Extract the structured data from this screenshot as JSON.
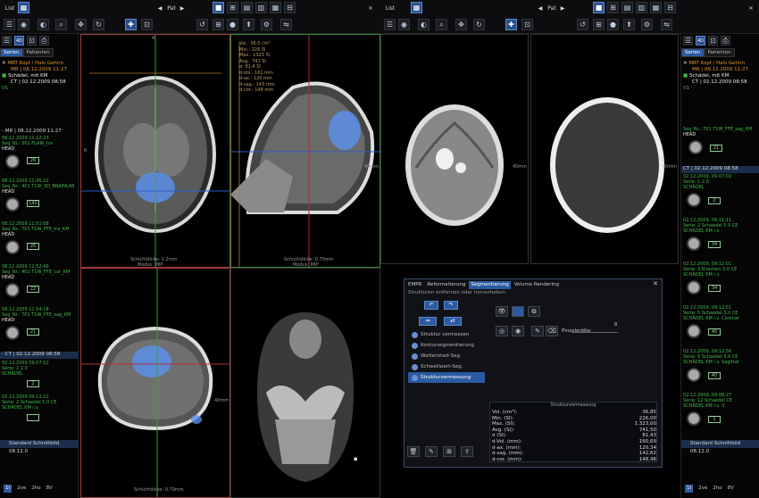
{
  "toolbar": {
    "list_label_left": "List",
    "pat_label_left": "Pat",
    "list_label_right": "List",
    "pat_label_right": "Pat"
  },
  "sidebar_left": {
    "tabs": [
      "Serien",
      "Patienten"
    ],
    "patient_lines": [
      "MRT Kopf / Hals Gehirn",
      "MR | 08.12.2009 11:27",
      "Schädel, mit KM",
      "CT | 02.12.2009 08:58"
    ],
    "version": "V1",
    "group_header": "- MR | 08.12.2009 11:27",
    "series": [
      {
        "time": "08.12.2009 11:22:23",
        "line2": "Seq_Nr.: 301 FLAIR_tra",
        "line3": "HEAD",
        "count": "26"
      },
      {
        "time": "08.12.2009 11:45:22",
        "line2": "Seq_Nr.: 401 T1W_3D_BRAINLAB",
        "line3": "HEAD",
        "count": "140"
      },
      {
        "time": "08.12.2009 11:51:08",
        "line2": "Seq_Nr.: 701 T1W_FFE_tra_KM",
        "line3": "HEAD",
        "count": "26"
      },
      {
        "time": "08.12.2009 11:52:49",
        "line2": "Seq_Nr.: 401 T1W_FFE_cor_KM",
        "line3": "HEAD",
        "count": "22"
      },
      {
        "time": "08.12.2009 11:54:18",
        "line2": "Seq_Nr.: 701 T1W_FFE_sag_KM",
        "line3": "HEAD",
        "count": "21"
      }
    ],
    "ct_header": "- CT | 02.12.2009 08:58",
    "ct_series": [
      {
        "time": "02.12.2009 09:07:02",
        "line2": "Serie: 1 2.0",
        "line3": "SCHÄDEL",
        "count": "2"
      },
      {
        "time": "02.12.2009 09:11:11",
        "line2": "Serie: 2 Schaedel 5.0 CE",
        "line3": "SCHÄDEL KM i.v.",
        "count": ""
      }
    ],
    "footer": "Standard Schnittbild 08.12.0",
    "footer_tabs": [
      "1I",
      "2ve",
      "2ho",
      "8V"
    ]
  },
  "sidebar_right": {
    "tabs": [
      "Serien",
      "Patienten"
    ],
    "patient_lines": [
      "MRT Kopf / Hals Gehirn",
      "MR | 08.12.2009 11:27",
      "Schädel, mit KM",
      "CT | 02.12.2009 08:58"
    ],
    "version": "V1",
    "top_series": {
      "time": "",
      "line2": "Seq_Nr.: 701 T1W_FFE_sag_KM",
      "line3": "HEAD",
      "count": "21"
    },
    "ct_header": "CT | 02.12.2009 08:58",
    "ct_series": [
      {
        "time": "02.12.2009, 09:07:02",
        "line2": "Serie: 1 2.0",
        "line3": "SCHÄDEL",
        "count": "2"
      },
      {
        "time": "02.12.2009, 09:11:11",
        "line2": "Serie: 2 Schaedel 5.0 CE",
        "line3": "SCHÄDEL KM i.v.",
        "count": "34"
      },
      {
        "time": "02.12.2009, 09:12:01",
        "line2": "Serie: 3 Knochen 5.0 CE",
        "line3": "SCHÄDEL KM i.v.",
        "count": "34"
      },
      {
        "time": "02.12.2009, 09:12:51",
        "line2": "Serie: 5 Schaedel 3.0 CE",
        "line3": "SCHÄDEL KM i.v. Coronar",
        "count": "40"
      },
      {
        "time": "02.12.2009, 09:12:56",
        "line2": "Serie: 9 Schaedel 3.0 CE",
        "line3": "SCHÄDEL KM i.v. Sagittal",
        "count": "40"
      },
      {
        "time": "02.12.2009, 09:08:27",
        "line2": "Serie: 12 Schaedel CE",
        "line3": "SCHÄDEL KM i.v. 3",
        "count": "1"
      }
    ],
    "footer": "Standard Schnittbild 08.12.0",
    "footer_tabs": [
      "1I",
      "2ve",
      "2ho",
      "8V"
    ]
  },
  "viewports": {
    "sag_measurements": [
      "Vol.: 36.0 cm³",
      "Min.: 226 SI",
      "Max.: 1323 SI",
      "Avg.: 741 SI",
      "σ: 81.4 SI",
      "d-Vol.: 161 mm",
      "d-ax.: 120 mm",
      "d-sag.: 143 mm",
      "d-cor.: 148 mm"
    ],
    "slice_label_1": "Schichtdicke: 1.2mm",
    "mode_label": "Modus: MIP",
    "slice_label_2": "Schichtdicke: 0.75mm",
    "slice_label_3": "Schichtdicke: 0.79mm",
    "dist_label": "40mm"
  },
  "panel": {
    "tabs": [
      "EMPR",
      "Reformatierung",
      "Segmentierung",
      "Volume Rendering"
    ],
    "subtitle": "Strukturen entfernen oder hervorheben",
    "segment_items": [
      "Struktur vermessen",
      "Kontursegmentierung",
      "Wattershed-Seg.",
      "Schwellwert-Seg.",
      "Strukturvermessung"
    ],
    "brush_label": "Pinselgröße:",
    "brush_value": "8",
    "stats_title": "Strukturvermessung",
    "stats": [
      {
        "label": "Vol. (cm³):",
        "value": "36,85"
      },
      {
        "label": "Min. (SI):",
        "value": "226,00"
      },
      {
        "label": "Max. (SI):",
        "value": "1.323,00"
      },
      {
        "label": "Avg. (SI):",
        "value": "741,50"
      },
      {
        "label": "σ (SI):",
        "value": "81,43"
      },
      {
        "label": "d-Vol. (mm):",
        "value": "160,69"
      },
      {
        "label": "d-ax. (mm):",
        "value": "120,34"
      },
      {
        "label": "d-sag. (mm):",
        "value": "142,62"
      },
      {
        "label": "d-cor. (mm):",
        "value": "148,46"
      }
    ]
  },
  "colors": {
    "accent": "#2b5aa0",
    "segmentation": "#5b8ee8",
    "patient_text": "#e0902a",
    "series_text": "#42b84a"
  }
}
